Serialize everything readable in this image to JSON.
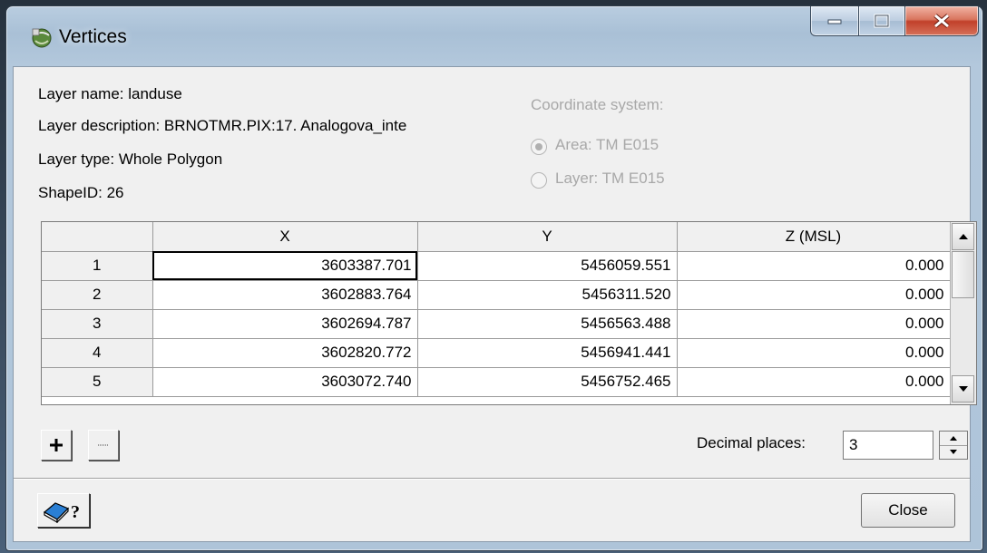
{
  "window": {
    "title": "Vertices",
    "icon": "app-globe-icon",
    "caption_buttons": [
      "minimize",
      "maximize",
      "close"
    ]
  },
  "layer_info": {
    "name_label": "Layer name: landuse",
    "description_label": "Layer description: BRNOTMR.PIX:17. Analogova_inte",
    "type_label": "Layer type: Whole Polygon",
    "shape_id_label": "ShapeID: 26"
  },
  "coordinate_system": {
    "label": "Coordinate system:",
    "options": [
      {
        "label": "Area: TM E015",
        "selected": true
      },
      {
        "label": "Layer: TM E015",
        "selected": false
      }
    ]
  },
  "grid": {
    "columns": [
      "",
      "X",
      "Y",
      "Z (MSL)"
    ],
    "rows": [
      {
        "index": "1",
        "x": "3603387.701",
        "y": "5456059.551",
        "z": "0.000"
      },
      {
        "index": "2",
        "x": "3602883.764",
        "y": "5456311.520",
        "z": "0.000"
      },
      {
        "index": "3",
        "x": "3602694.787",
        "y": "5456563.488",
        "z": "0.000"
      },
      {
        "index": "4",
        "x": "3602820.772",
        "y": "5456941.441",
        "z": "0.000"
      },
      {
        "index": "5",
        "x": "3603072.740",
        "y": "5456752.465",
        "z": "0.000"
      }
    ],
    "selected_cell": "row 1, X"
  },
  "toolbar": {
    "add_icon": "plus-icon",
    "remove_icon": "minus-icon"
  },
  "decimal_places": {
    "label": "Decimal places:",
    "value": "3"
  },
  "footer": {
    "help_icon": "help-book-icon",
    "close_label": "Close"
  }
}
